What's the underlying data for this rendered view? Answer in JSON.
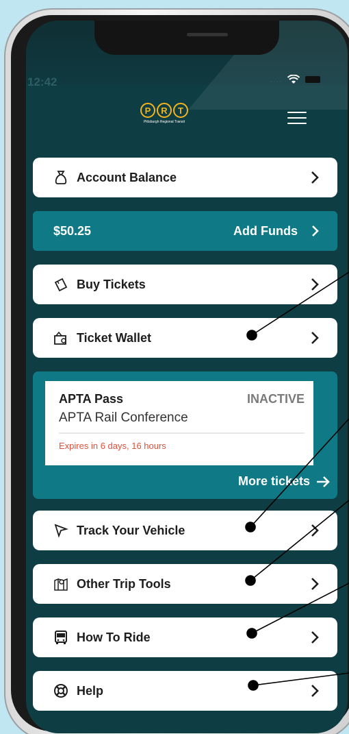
{
  "status_bar": {
    "time": "12:42",
    "signal": "...."
  },
  "logo": {
    "letters": [
      "P",
      "R",
      "T"
    ],
    "subtitle": "Pittsburgh Regional Transit"
  },
  "menu": {
    "account_balance": "Account Balance",
    "buy_tickets": "Buy Tickets",
    "ticket_wallet": "Ticket Wallet",
    "track_vehicle": "Track Your Vehicle",
    "other_trip_tools": "Other Trip Tools",
    "how_to_ride": "How To Ride",
    "help": "Help"
  },
  "funds": {
    "balance": "$50.25",
    "add_label": "Add Funds"
  },
  "pass": {
    "name": "APTA Pass",
    "status": "INACTIVE",
    "event": "APTA Rail Conference",
    "expires": "Expires in 6 days, 16 hours",
    "more_label": "More tickets"
  },
  "colors": {
    "brand_yellow": "#f3b51b",
    "teal": "#0f7a86",
    "screen_bg": "#0f3d44",
    "expire_red": "#e0503b"
  },
  "icons": [
    "money-bag-icon",
    "tickets-icon",
    "wallet-icon",
    "cursor-icon",
    "map-pin-icon",
    "bus-icon",
    "lifebuoy-icon",
    "chevron-right-icon",
    "menu-icon",
    "arrow-right-icon"
  ]
}
